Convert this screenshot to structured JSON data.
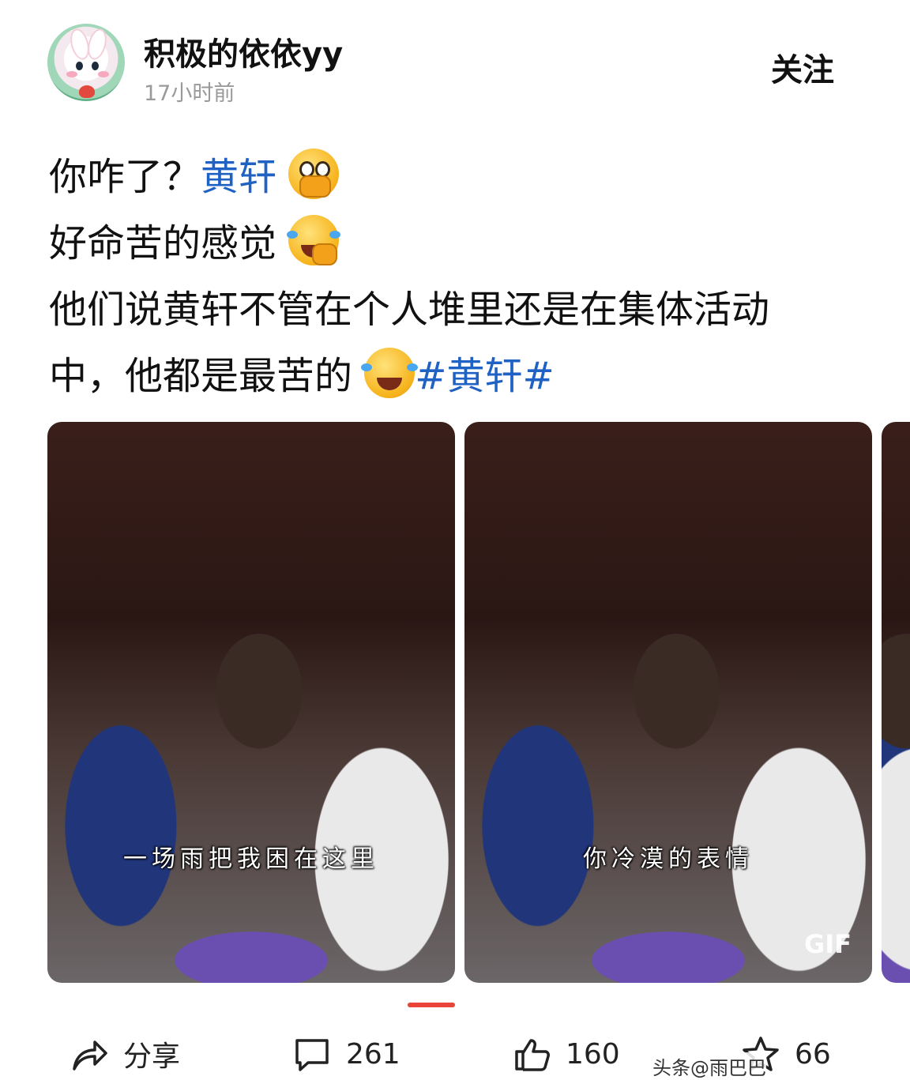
{
  "author": {
    "name": "积极的依依yy",
    "time": "17小时前",
    "follow_label": "关注"
  },
  "post": {
    "line1_text": "你咋了？",
    "line1_topic": "黄轩",
    "line2_text": "好命苦的感觉",
    "line3_text": "他们说黄轩不管在个人堆里还是在集体活动",
    "line4_text": "中，他都是最苦的",
    "hashtag": "#黄轩#",
    "emojis": [
      "holding-back-tears-emoji",
      "loudly-crying-laughing-emoji",
      "face-with-tears-of-joy-emoji"
    ]
  },
  "gallery": {
    "images": [
      {
        "subtitle": "一场雨把我困在这里",
        "badge": ""
      },
      {
        "subtitle": "你冷漠的表情",
        "badge": "GIF"
      },
      {
        "subtitle": "",
        "badge": ""
      }
    ],
    "indicator_color": "#e8443a"
  },
  "actions": {
    "share_label": "分享",
    "comment_count": "261",
    "like_count": "160",
    "fav_count": "66"
  },
  "watermark": "头条@雨巴巴",
  "colors": {
    "topic_blue": "#1f62c4",
    "accent_red": "#e8443a"
  }
}
